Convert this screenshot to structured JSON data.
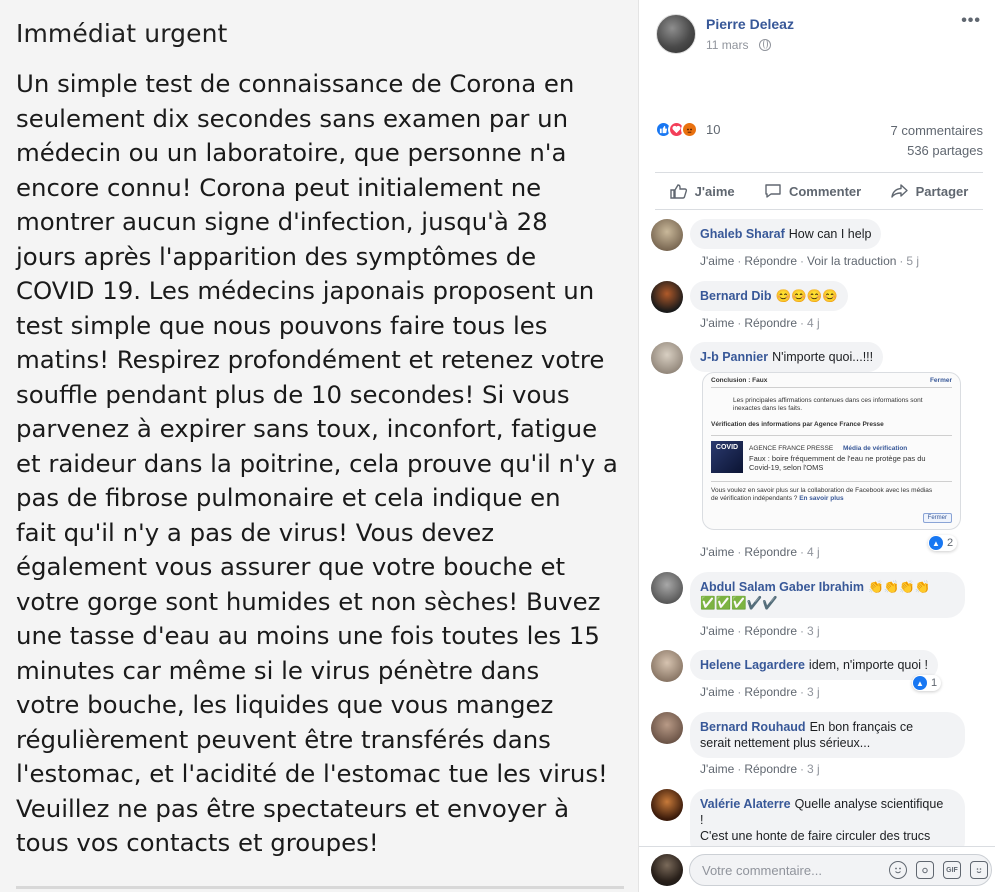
{
  "photo": {
    "title": "Immédiat urgent",
    "lines": [
      "Un simple test de connaissance de Corona en",
      "seulement dix secondes sans examen par un",
      "médecin ou un laboratoire, que personne n'a",
      "encore connu! Corona peut initialement ne",
      "montrer aucun signe d'infection, jusqu'à 28",
      "jours après l'apparition des symptômes de",
      "COVID 19. Les médecins japonais proposent un",
      "test simple que nous pouvons faire tous les",
      "matins! Respirez profondément et retenez votre",
      "souffle pendant plus de 10 secondes! Si vous",
      "parvenez à expirer sans toux, inconfort, fatigue",
      "et raideur dans la poitrine, cela prouve qu'il n'y a",
      "pas de fibrose pulmonaire et cela indique en",
      "fait qu'il n'y a pas de virus! Vous devez",
      "également vous assurer que votre bouche et",
      "votre gorge sont humides et non sèches! Buvez",
      "une tasse d'eau au moins une fois toutes les 15",
      "minutes car même si le virus pénètre dans",
      "votre bouche, les liquides que vous mangez",
      "régulièrement peuvent être transférés dans",
      "l'estomac, et l'acidité de l'estomac tue les virus!",
      "Veuillez ne pas être spectateurs et envoyer à",
      "tous vos contacts et groupes!"
    ]
  },
  "post": {
    "author": "Pierre Deleaz",
    "date": "11 mars",
    "more": "•••",
    "privacy_icon": "globe-icon",
    "reaction_count": "10",
    "comments_count": "7 commentaires",
    "shares_count": "536 partages"
  },
  "actions": {
    "like": "J'aime",
    "comment": "Commenter",
    "share": "Partager"
  },
  "meta_labels": {
    "like": "J'aime",
    "reply": "Répondre",
    "translate": "Voir la traduction"
  },
  "comments": [
    {
      "name": "Ghaleb Sharaf",
      "text": "How can I help",
      "time": "5 j"
    },
    {
      "name": "Bernard Dib",
      "text": "😊😊😊😊",
      "time": "4 j"
    },
    {
      "name": "J-b Pannier",
      "text": "N'importe quoi...!!!",
      "time": "4 j",
      "likes": "2"
    },
    {
      "name": "Abdul Salam Gaber Ibrahim",
      "text": "👏👏👏👏",
      "text2": "✅✅✅✔️✔️",
      "time": "3 j"
    },
    {
      "name": "Helene Lagardere",
      "text": "idem, n'importe quoi !",
      "time": "3 j",
      "likes": "1"
    },
    {
      "name": "Bernard Rouhaud",
      "text": "En bon français ce",
      "text2": "serait nettement plus sérieux...",
      "time": "3 j"
    },
    {
      "name": "Valérie Alaterre",
      "text": "Quelle analyse scientifique",
      "text2": "!",
      "text3": "C'est une honte de faire circuler des trucs"
    }
  ],
  "factcheck": {
    "header": "Conclusion : Faux",
    "close": "Fermer",
    "intro": "Les principales affirmations contenues dans ces informations sont inexactes dans les faits.",
    "verif": "Vérification des informations par Agence France Presse",
    "thumb": "COVID",
    "agency": "AGENCE FRANCE PRESSE",
    "media": "Média de vérification",
    "claim": "Faux : boire fréquemment de l'eau ne protège pas du Covid-19, selon l'OMS",
    "more": "Vous voulez en savoir plus sur la collaboration de Facebook avec les médias de vérification indépendants ?",
    "more_link": "En savoir plus",
    "button": "Fermer"
  },
  "composer": {
    "placeholder": "Votre commentaire...",
    "gif": "GIF"
  },
  "colors": {
    "link": "#385898",
    "like": "#1877f2",
    "love": "#f33e58",
    "angry": "#e9710f",
    "bubble": "#f2f3f5"
  }
}
